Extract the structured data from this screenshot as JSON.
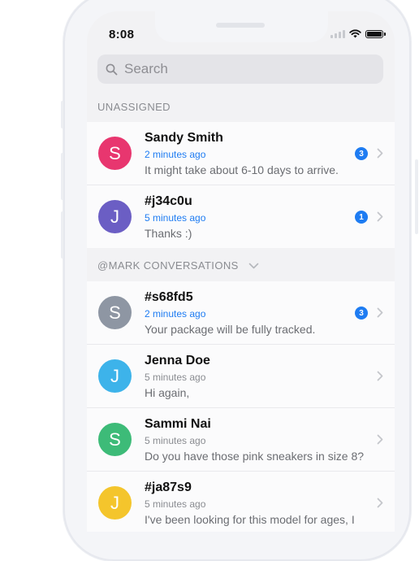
{
  "status_bar": {
    "time": "8:08"
  },
  "search": {
    "placeholder": "Search"
  },
  "sections": [
    {
      "title": "UNASSIGNED",
      "has_chevron": false,
      "conversations": [
        {
          "name": "Sandy Smith",
          "initial": "S",
          "avatar_color": "#e8366f",
          "time_ago": "2 minutes ago",
          "time_color": "#1e7cf2",
          "preview": "It might take about 6-10 days to arrive.",
          "unread": "3"
        },
        {
          "name": "#j34c0u",
          "initial": "J",
          "avatar_color": "#6b5ec4",
          "time_ago": "5 minutes ago",
          "time_color": "#1e7cf2",
          "preview": "Thanks :)",
          "unread": "1"
        }
      ]
    },
    {
      "title": "@MARK CONVERSATIONS",
      "has_chevron": true,
      "conversations": [
        {
          "name": "#s68fd5",
          "initial": "S",
          "avatar_color": "#8e96a3",
          "time_ago": "2 minutes ago",
          "time_color": "#1e7cf2",
          "preview": "Your package will be fully tracked.",
          "unread": "3"
        },
        {
          "name": "Jenna Doe",
          "initial": "J",
          "avatar_color": "#3db3ea",
          "time_ago": "5 minutes ago",
          "time_color": "#8a8c91",
          "preview": "Hi again,",
          "unread": ""
        },
        {
          "name": "Sammi Nai",
          "initial": "S",
          "avatar_color": "#3dbb78",
          "time_ago": "5 minutes ago",
          "time_color": "#8a8c91",
          "preview": "Do you have those pink sneakers in size 8?",
          "unread": ""
        },
        {
          "name": "#ja87s9",
          "initial": "J",
          "avatar_color": "#f4c52c",
          "time_ago": "5 minutes ago",
          "time_color": "#8a8c91",
          "preview": "I've been looking for this model for ages, I",
          "unread": ""
        }
      ]
    }
  ]
}
